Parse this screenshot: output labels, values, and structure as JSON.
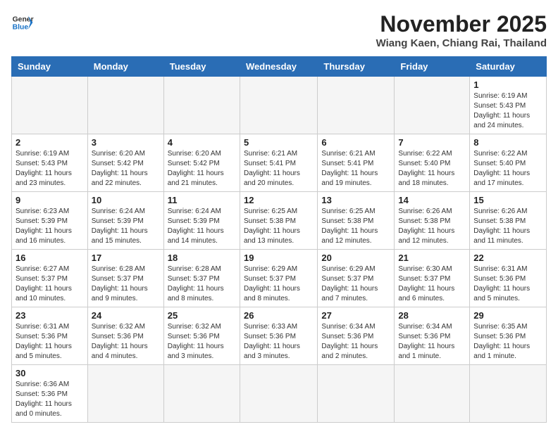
{
  "header": {
    "logo_line1": "General",
    "logo_line2": "Blue",
    "month": "November 2025",
    "location": "Wiang Kaen, Chiang Rai, Thailand"
  },
  "weekdays": [
    "Sunday",
    "Monday",
    "Tuesday",
    "Wednesday",
    "Thursday",
    "Friday",
    "Saturday"
  ],
  "days": [
    {
      "num": "",
      "info": ""
    },
    {
      "num": "",
      "info": ""
    },
    {
      "num": "",
      "info": ""
    },
    {
      "num": "",
      "info": ""
    },
    {
      "num": "",
      "info": ""
    },
    {
      "num": "",
      "info": ""
    },
    {
      "num": "1",
      "info": "Sunrise: 6:19 AM\nSunset: 5:43 PM\nDaylight: 11 hours\nand 24 minutes."
    },
    {
      "num": "2",
      "info": "Sunrise: 6:19 AM\nSunset: 5:43 PM\nDaylight: 11 hours\nand 23 minutes."
    },
    {
      "num": "3",
      "info": "Sunrise: 6:20 AM\nSunset: 5:42 PM\nDaylight: 11 hours\nand 22 minutes."
    },
    {
      "num": "4",
      "info": "Sunrise: 6:20 AM\nSunset: 5:42 PM\nDaylight: 11 hours\nand 21 minutes."
    },
    {
      "num": "5",
      "info": "Sunrise: 6:21 AM\nSunset: 5:41 PM\nDaylight: 11 hours\nand 20 minutes."
    },
    {
      "num": "6",
      "info": "Sunrise: 6:21 AM\nSunset: 5:41 PM\nDaylight: 11 hours\nand 19 minutes."
    },
    {
      "num": "7",
      "info": "Sunrise: 6:22 AM\nSunset: 5:40 PM\nDaylight: 11 hours\nand 18 minutes."
    },
    {
      "num": "8",
      "info": "Sunrise: 6:22 AM\nSunset: 5:40 PM\nDaylight: 11 hours\nand 17 minutes."
    },
    {
      "num": "9",
      "info": "Sunrise: 6:23 AM\nSunset: 5:39 PM\nDaylight: 11 hours\nand 16 minutes."
    },
    {
      "num": "10",
      "info": "Sunrise: 6:24 AM\nSunset: 5:39 PM\nDaylight: 11 hours\nand 15 minutes."
    },
    {
      "num": "11",
      "info": "Sunrise: 6:24 AM\nSunset: 5:39 PM\nDaylight: 11 hours\nand 14 minutes."
    },
    {
      "num": "12",
      "info": "Sunrise: 6:25 AM\nSunset: 5:38 PM\nDaylight: 11 hours\nand 13 minutes."
    },
    {
      "num": "13",
      "info": "Sunrise: 6:25 AM\nSunset: 5:38 PM\nDaylight: 11 hours\nand 12 minutes."
    },
    {
      "num": "14",
      "info": "Sunrise: 6:26 AM\nSunset: 5:38 PM\nDaylight: 11 hours\nand 12 minutes."
    },
    {
      "num": "15",
      "info": "Sunrise: 6:26 AM\nSunset: 5:38 PM\nDaylight: 11 hours\nand 11 minutes."
    },
    {
      "num": "16",
      "info": "Sunrise: 6:27 AM\nSunset: 5:37 PM\nDaylight: 11 hours\nand 10 minutes."
    },
    {
      "num": "17",
      "info": "Sunrise: 6:28 AM\nSunset: 5:37 PM\nDaylight: 11 hours\nand 9 minutes."
    },
    {
      "num": "18",
      "info": "Sunrise: 6:28 AM\nSunset: 5:37 PM\nDaylight: 11 hours\nand 8 minutes."
    },
    {
      "num": "19",
      "info": "Sunrise: 6:29 AM\nSunset: 5:37 PM\nDaylight: 11 hours\nand 8 minutes."
    },
    {
      "num": "20",
      "info": "Sunrise: 6:29 AM\nSunset: 5:37 PM\nDaylight: 11 hours\nand 7 minutes."
    },
    {
      "num": "21",
      "info": "Sunrise: 6:30 AM\nSunset: 5:37 PM\nDaylight: 11 hours\nand 6 minutes."
    },
    {
      "num": "22",
      "info": "Sunrise: 6:31 AM\nSunset: 5:36 PM\nDaylight: 11 hours\nand 5 minutes."
    },
    {
      "num": "23",
      "info": "Sunrise: 6:31 AM\nSunset: 5:36 PM\nDaylight: 11 hours\nand 5 minutes."
    },
    {
      "num": "24",
      "info": "Sunrise: 6:32 AM\nSunset: 5:36 PM\nDaylight: 11 hours\nand 4 minutes."
    },
    {
      "num": "25",
      "info": "Sunrise: 6:32 AM\nSunset: 5:36 PM\nDaylight: 11 hours\nand 3 minutes."
    },
    {
      "num": "26",
      "info": "Sunrise: 6:33 AM\nSunset: 5:36 PM\nDaylight: 11 hours\nand 3 minutes."
    },
    {
      "num": "27",
      "info": "Sunrise: 6:34 AM\nSunset: 5:36 PM\nDaylight: 11 hours\nand 2 minutes."
    },
    {
      "num": "28",
      "info": "Sunrise: 6:34 AM\nSunset: 5:36 PM\nDaylight: 11 hours\nand 1 minute."
    },
    {
      "num": "29",
      "info": "Sunrise: 6:35 AM\nSunset: 5:36 PM\nDaylight: 11 hours\nand 1 minute."
    },
    {
      "num": "30",
      "info": "Sunrise: 6:36 AM\nSunset: 5:36 PM\nDaylight: 11 hours\nand 0 minutes."
    },
    {
      "num": "",
      "info": ""
    },
    {
      "num": "",
      "info": ""
    },
    {
      "num": "",
      "info": ""
    },
    {
      "num": "",
      "info": ""
    },
    {
      "num": "",
      "info": ""
    },
    {
      "num": "",
      "info": ""
    }
  ]
}
